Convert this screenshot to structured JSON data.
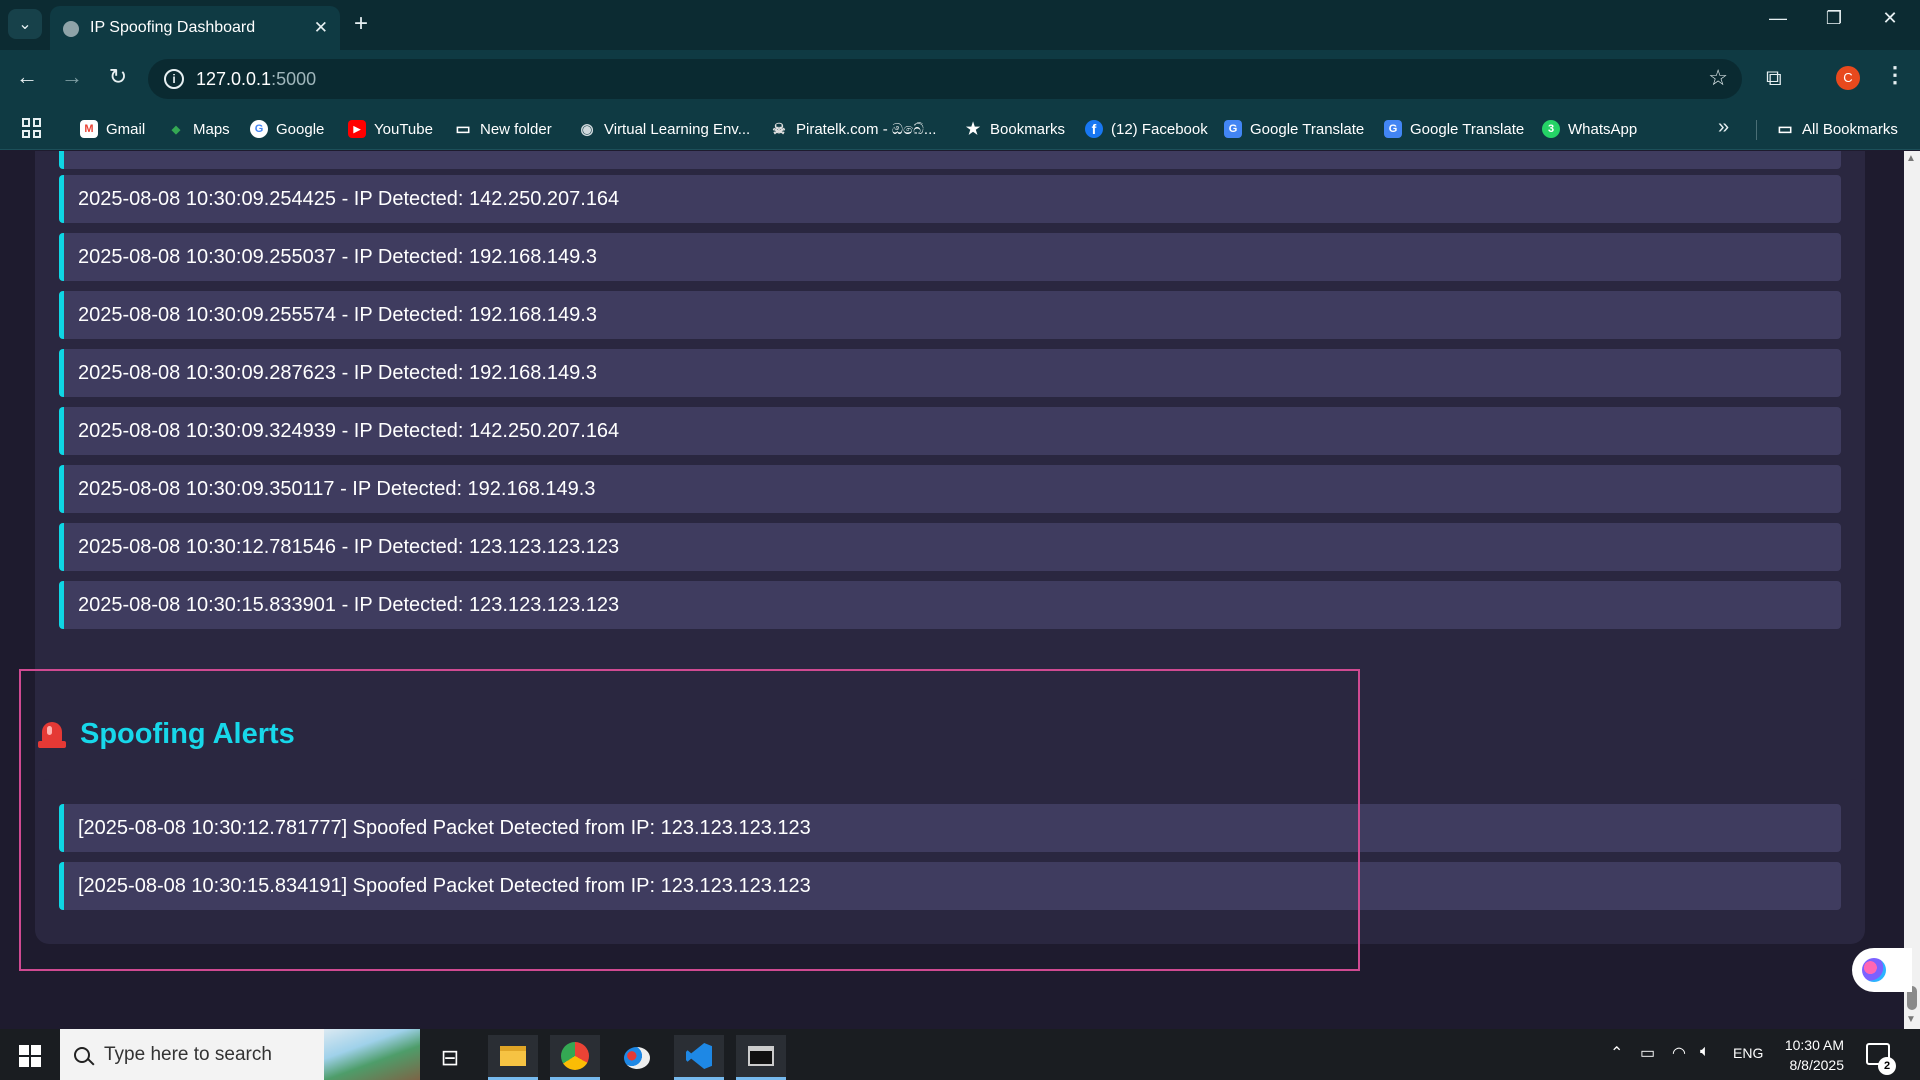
{
  "browser": {
    "tab_title": "IP Spoofing Dashboard",
    "tab_close": "✕",
    "new_tab": "+",
    "url_host": "127.0.0.1",
    "url_port": ":5000",
    "profile_initial": "C",
    "window_controls": [
      "—",
      "❐",
      "✕"
    ]
  },
  "bookmarks": [
    {
      "label": "Gmail",
      "icon": "gmail-icon",
      "color": "#ea4335",
      "glyph": "M"
    },
    {
      "label": "Maps",
      "icon": "maps-icon",
      "color": "#34a853",
      "glyph": "◆"
    },
    {
      "label": "Google",
      "icon": "google-icon",
      "color": "#4285f4",
      "glyph": "G"
    },
    {
      "label": "YouTube",
      "icon": "youtube-icon",
      "color": "#ff0000",
      "glyph": "▶"
    },
    {
      "label": "New folder",
      "icon": "folder-icon",
      "color": "transparent",
      "glyph": "▭"
    },
    {
      "label": "Virtual Learning Env...",
      "icon": "vle-icon",
      "color": "#6b6b6b",
      "glyph": "◉"
    },
    {
      "label": "Piratelk.com - ඔබේ...",
      "icon": "pirate-icon",
      "color": "#333333",
      "glyph": "☠"
    },
    {
      "label": "Bookmarks",
      "icon": "star-icon",
      "color": "transparent",
      "glyph": "★"
    },
    {
      "label": "(12) Facebook",
      "icon": "facebook-icon",
      "color": "#1877f2",
      "glyph": "f"
    },
    {
      "label": "Google Translate",
      "icon": "translate-icon",
      "color": "#4285f4",
      "glyph": "G"
    },
    {
      "label": "Google Translate",
      "icon": "translate-icon",
      "color": "#4285f4",
      "glyph": "G"
    },
    {
      "label": "WhatsApp",
      "icon": "whatsapp-icon",
      "color": "#25d366",
      "glyph": "3"
    }
  ],
  "all_bookmarks_label": "All Bookmarks",
  "ip_log": [
    "2025-08-08 10:30:09.254425 - IP Detected: 142.250.207.164",
    "2025-08-08 10:30:09.255037 - IP Detected: 192.168.149.3",
    "2025-08-08 10:30:09.255574 - IP Detected: 192.168.149.3",
    "2025-08-08 10:30:09.287623 - IP Detected: 192.168.149.3",
    "2025-08-08 10:30:09.324939 - IP Detected: 142.250.207.164",
    "2025-08-08 10:30:09.350117 - IP Detected: 192.168.149.3",
    "2025-08-08 10:30:12.781546 - IP Detected: 123.123.123.123",
    "2025-08-08 10:30:15.833901 - IP Detected: 123.123.123.123"
  ],
  "alerts": {
    "title": "Spoofing Alerts",
    "items": [
      "[2025-08-08 10:30:12.781777] Spoofed Packet Detected from IP: 123.123.123.123",
      "[2025-08-08 10:30:15.834191] Spoofed Packet Detected from IP: 123.123.123.123"
    ]
  },
  "taskbar": {
    "search_placeholder": "Type here to search",
    "language": "ENG",
    "time": "10:30 AM",
    "date": "8/8/2025",
    "notification_count": "2"
  },
  "colors": {
    "page_bg": "#1e1b2e",
    "panel_bg": "#2a2740",
    "item_bg": "#3f3c5f",
    "accent_cyan": "#0fd6e4",
    "highlight_pink": "#d04a92"
  }
}
